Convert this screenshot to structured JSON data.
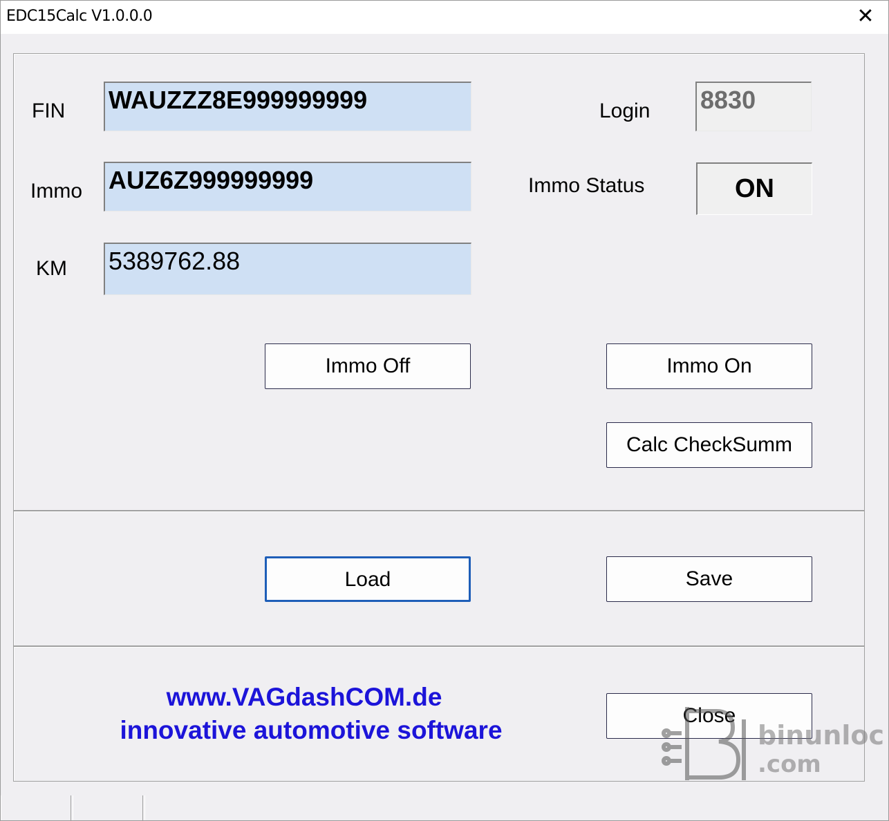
{
  "window": {
    "title": "EDC15Calc V1.0.0.0",
    "close_glyph": "✕"
  },
  "fields": {
    "fin": {
      "label": "FIN",
      "value": "WAUZZZ8E999999999"
    },
    "immo": {
      "label": "Immo",
      "value": "AUZ6Z999999999"
    },
    "km": {
      "label": "KM",
      "value": "5389762.88"
    },
    "login": {
      "label": "Login",
      "value": "8830"
    },
    "immo_status": {
      "label": "Immo Status",
      "value": "ON"
    }
  },
  "buttons": {
    "immo_off": "Immo Off",
    "immo_on": "Immo On",
    "calc_checksum": "Calc CheckSumm",
    "load": "Load",
    "save": "Save",
    "close": "Close"
  },
  "footer": {
    "url": "www.VAGdashCOM.de",
    "tagline": "innovative automotive software"
  },
  "watermark": {
    "brand": "binunlock",
    "domain": ".com"
  },
  "colors": {
    "field_bg": "#cfe0f4",
    "link_blue": "#1c14d9",
    "default_button_border": "#1e5eb8"
  }
}
